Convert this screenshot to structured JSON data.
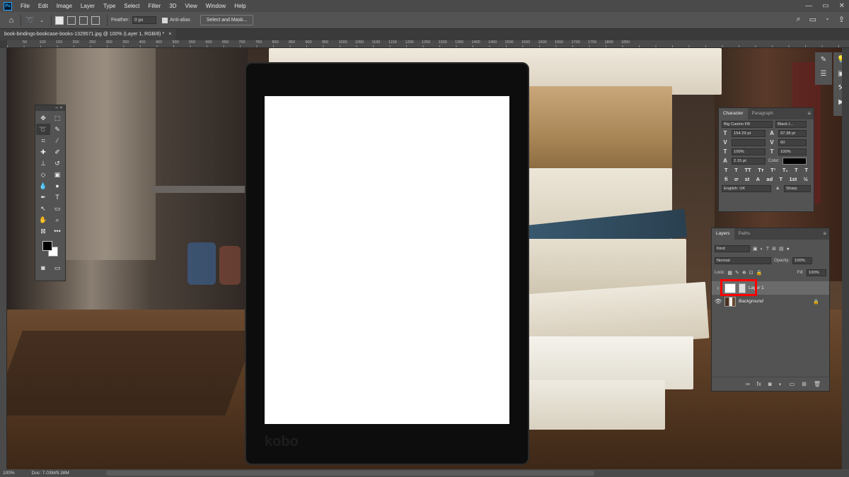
{
  "menubar": {
    "logo": "Ps",
    "items": [
      "File",
      "Edit",
      "Image",
      "Layer",
      "Type",
      "Select",
      "Filter",
      "3D",
      "View",
      "Window",
      "Help"
    ],
    "window_controls": [
      "⌕",
      "▭",
      "✕"
    ]
  },
  "options": {
    "feather_label": "Feather:",
    "feather_value": "0 px",
    "antialias_label": "Anti-alias",
    "select_mask_label": "Select and Mask..."
  },
  "document": {
    "tab_title": "book-bindings-bookcase-books-1329571.jpg @ 100% (Layer 1, RGB/8) *",
    "tab_close": "×"
  },
  "ruler": {
    "ticks": [
      "50",
      "100",
      "150",
      "200",
      "250",
      "300",
      "350",
      "400",
      "450",
      "500",
      "550",
      "600",
      "650",
      "700",
      "750",
      "800",
      "850",
      "900",
      "950",
      "1000",
      "1050",
      "1100",
      "1150",
      "1200",
      "1250",
      "1300",
      "1350",
      "1400",
      "1450",
      "1500",
      "1550",
      "1600",
      "1650",
      "1700",
      "1750",
      "1800",
      "1850"
    ]
  },
  "canvas": {
    "device_brand": "kobo"
  },
  "character": {
    "tab_character": "Character",
    "tab_paragraph": "Paragraph",
    "font_family": "Big Caslon FB",
    "font_style": "Black I...",
    "font_size": "154.29 pt",
    "leading": "97.38 pt",
    "kerning": "",
    "tracking": "60",
    "vertical_scale": "100%",
    "horizontal_scale": "100%",
    "baseline_shift": "2.15 pt",
    "color_label": "Color:",
    "language": "English: UK",
    "antialias": "Sharp",
    "style_buttons": [
      "T",
      "T",
      "TT",
      "Tт",
      "T¹",
      "T₁",
      "T",
      "T"
    ],
    "opentype_buttons": [
      "fi",
      "ơ",
      "st",
      "A",
      "ad",
      "T",
      "1st",
      "½"
    ]
  },
  "layers": {
    "tab_layers": "Layers",
    "tab_paths": "Paths",
    "filter_kind": "Kind",
    "blend_mode": "Normal",
    "opacity_label": "Opacity:",
    "opacity_value": "100%",
    "lock_label": "Lock:",
    "fill_label": "Fill:",
    "fill_value": "100%",
    "items": [
      {
        "name": "Layer 1",
        "selected": true
      },
      {
        "name": "Background",
        "selected": false
      }
    ]
  },
  "status": {
    "zoom": "100%",
    "doc_info": "Doc: 7.03M/9.38M"
  },
  "colors": {
    "highlight": "#ff0000",
    "ps_blue": "#31a8ff"
  }
}
